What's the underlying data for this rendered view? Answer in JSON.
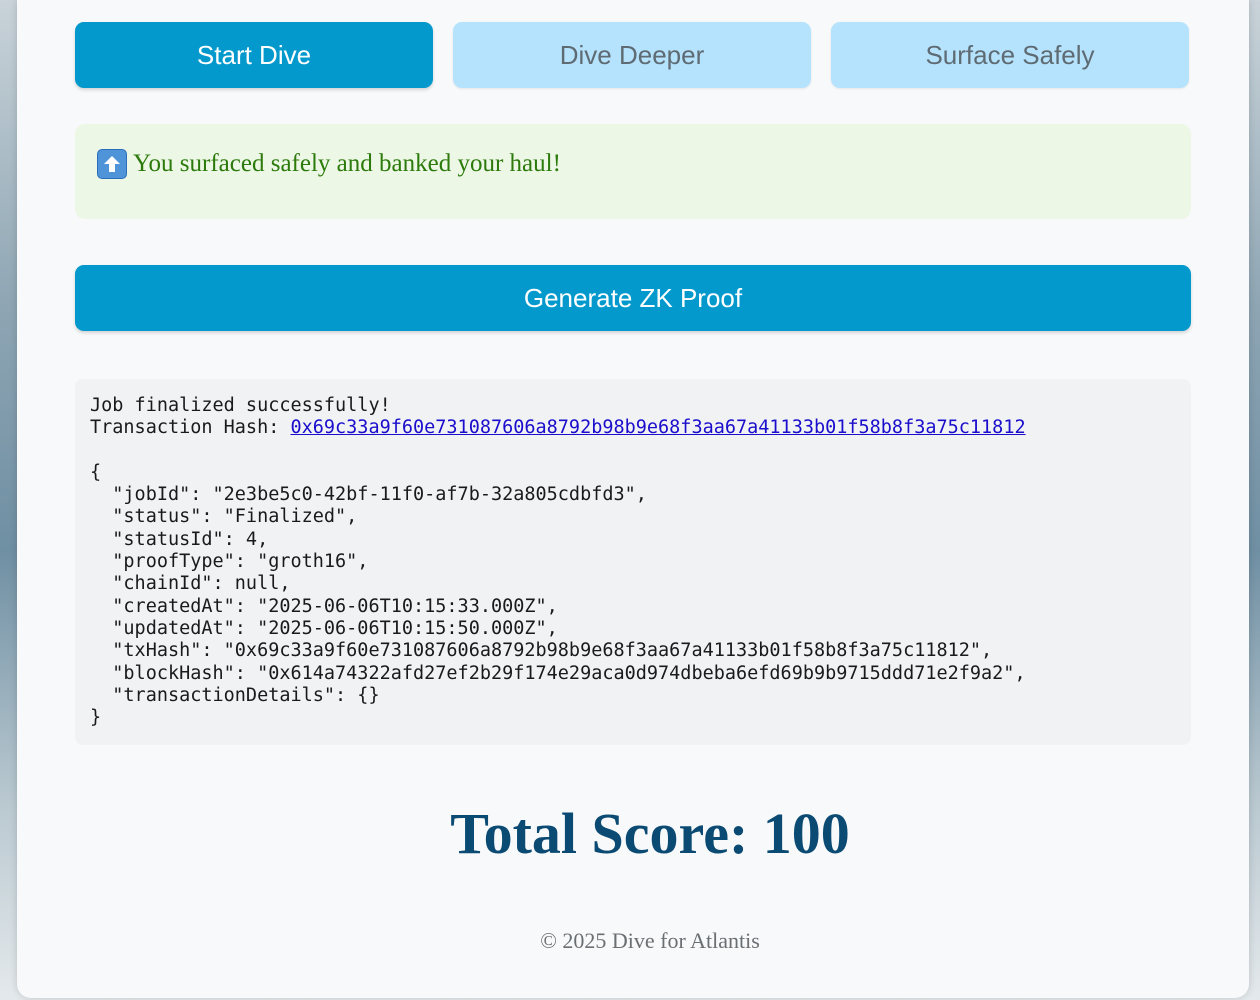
{
  "buttons": {
    "start_dive": "Start Dive",
    "dive_deeper": "Dive Deeper",
    "surface_safely": "Surface Safely"
  },
  "status": {
    "icon": "up-arrow-icon",
    "message": "You surfaced safely and banked your haul!"
  },
  "generate_button": "Generate ZK Proof",
  "result": {
    "job_message": "Job finalized successfully!",
    "tx_label": "Transaction Hash: ",
    "tx_hash": "0x69c33a9f60e731087606a8792b98b9e68f3aa67a41133b01f58b8f3a75c11812",
    "json_text": "{\n  \"jobId\": \"2e3be5c0-42bf-11f0-af7b-32a805cdbfd3\",\n  \"status\": \"Finalized\",\n  \"statusId\": 4,\n  \"proofType\": \"groth16\",\n  \"chainId\": null,\n  \"createdAt\": \"2025-06-06T10:15:33.000Z\",\n  \"updatedAt\": \"2025-06-06T10:15:50.000Z\",\n  \"txHash\": \"0x69c33a9f60e731087606a8792b98b9e68f3aa67a41133b01f58b8f3a75c11812\",\n  \"blockHash\": \"0x614a74322afd27ef2b29f174e29aca0d974dbeba6efd69b9b9715ddd71e2f9a2\",\n  \"transactionDetails\": {}\n}"
  },
  "score": "Total Score: 100",
  "footer": "© 2025 Dive for Atlantis",
  "colors": {
    "primary": "#0399cc",
    "primary_light": "#b5e3fe",
    "success_bg": "#edf7e6",
    "success_text": "#2b7a0b",
    "score_text": "#0a4a73"
  }
}
